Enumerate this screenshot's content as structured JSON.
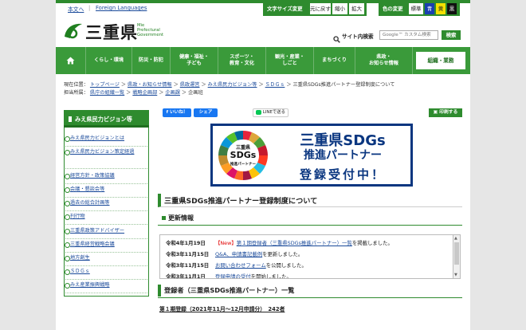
{
  "header": {
    "skip_links": [
      "本文へ",
      "Foreign Languages"
    ],
    "font_size_label": "文字サイズ変更",
    "font_size_buttons": [
      "元に戻す",
      "縮小",
      "拡大"
    ],
    "color_label": "色の変更",
    "color_buttons": [
      "標準",
      "青",
      "黄",
      "黒"
    ],
    "logo_text": "三重県",
    "logo_english": [
      "Mie",
      "Prefectural",
      "Government"
    ],
    "search_label": "サイト内検索",
    "search_placeholder": "Google™ カスタム検索",
    "search_button": "検索"
  },
  "nav": [
    "くらし・環境",
    "防災・防犯",
    "健康・福祉・\n子ども",
    "スポーツ・\n教育・文化",
    "観光・産業・\nしごと",
    "まちづくり",
    "県政・\nお知らせ情報",
    "組織・業務"
  ],
  "breadcrumb": {
    "label": "現在位置：",
    "items": [
      "トップページ",
      "県政・お知らせ情報",
      "県政運営",
      "みえ県民力ビジョン等",
      "ＳＤＧｓ"
    ],
    "current": "三重県SDGs推進パートナー登録制度について",
    "label2": "担当所属：",
    "items2": [
      "県庁の組織一覧",
      "戦略企画部",
      "企画課",
      "企画班"
    ]
  },
  "sidebar": {
    "title": "みえ県民力ビジョン等",
    "items": [
      "みえ県民力ビジョンとは",
      "みえ県民力ビジョン策定経過",
      "経営方針・政策協議",
      "会議・懇談会等",
      "過去の総合計画等",
      "刊行物",
      "三重県政策アドバイザー",
      "三重県経営戦略会議",
      "地方創生",
      "ＳＤＧｓ",
      "みえ産業振興戦略"
    ]
  },
  "social": {
    "like": "いいね！",
    "share": "シェア",
    "line": "LINEで送る",
    "print": "印刷する"
  },
  "banner": {
    "title": "三重県SDGs",
    "subtitle": "推進パートナー",
    "cta": "登録受付中！",
    "logo_top": "三重県",
    "logo_mid": "SDGs",
    "logo_bottom": "推進パートナー"
  },
  "main": {
    "page_title": "三重県SDGs推進パートナー登録制度について",
    "updates_heading": "更新情報",
    "updates": [
      {
        "date": "令和4年1月19日",
        "new": "【New】",
        "text_link": "第１期登録者（三重県SDGs推進パートナー）一覧",
        "text_rest": "を掲載しました。"
      },
      {
        "date": "令和3年11月15日",
        "new": "",
        "text_link": "Q&A、申請書記載例",
        "text_rest": "を更新しました。"
      },
      {
        "date": "令和3年11月15日",
        "new": "",
        "text_link": "お問い合わせフォーム",
        "text_rest": "を公開しました。"
      },
      {
        "date": "令和3年11月1日",
        "new": "",
        "text_link": "登録申請の受付",
        "text_rest": "を開始しました。"
      }
    ],
    "registrants_heading": "登録者（三重県SDGs推進パートナー）一覧",
    "registrants_link": "第１期登録（2021年11月～12月申請分）　242者"
  },
  "colors": {
    "green": "#2e8b2e",
    "dark_green": "#1f6f1f",
    "header_green": "#3a9a3a",
    "new_red": "#e00000",
    "link": "#1a4a9a"
  }
}
